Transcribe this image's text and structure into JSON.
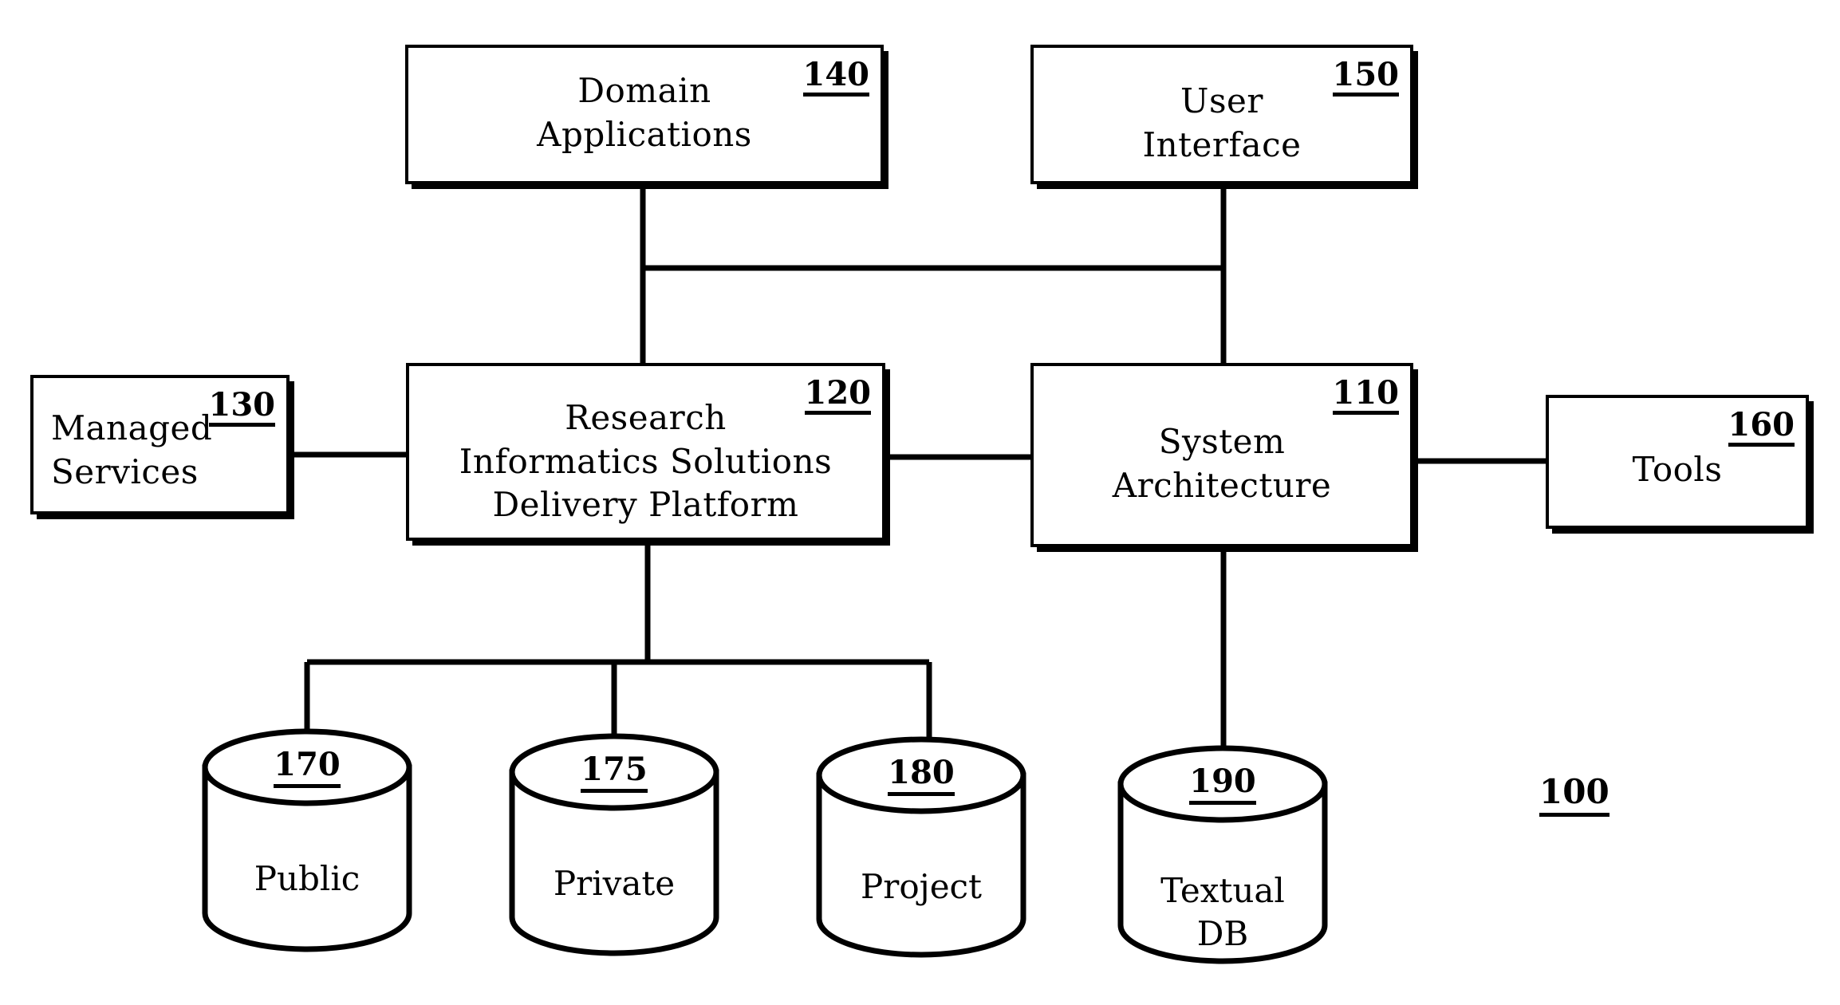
{
  "figure": {
    "reference_numeral": "100",
    "background_color": "#ffffff",
    "line_color": "#000000"
  },
  "boxes": [
    {
      "id": "domain-applications",
      "numeral": "140",
      "text": "Domain\nApplications",
      "align": "center"
    },
    {
      "id": "user-interface",
      "numeral": "150",
      "text": "User\nInterface",
      "align": "center"
    },
    {
      "id": "managed-services",
      "numeral": "130",
      "text": "Managed\nServices",
      "align": "left"
    },
    {
      "id": "research-informatics-solutions-delivery-platform",
      "numeral": "120",
      "text": "Research\nInformatics  Solutions\nDelivery  Platform",
      "align": "center"
    },
    {
      "id": "system-architecture",
      "numeral": "110",
      "text": "System\nArchitecture",
      "align": "center"
    },
    {
      "id": "tools",
      "numeral": "160",
      "text": "Tools",
      "align": "center"
    }
  ],
  "cylinders": [
    {
      "id": "public-db",
      "numeral": "170",
      "text": "Public"
    },
    {
      "id": "private-db",
      "numeral": "175",
      "text": "Private"
    },
    {
      "id": "project-db",
      "numeral": "180",
      "text": "Project"
    },
    {
      "id": "textual-db",
      "numeral": "190",
      "text": "Textual\nDB"
    }
  ]
}
